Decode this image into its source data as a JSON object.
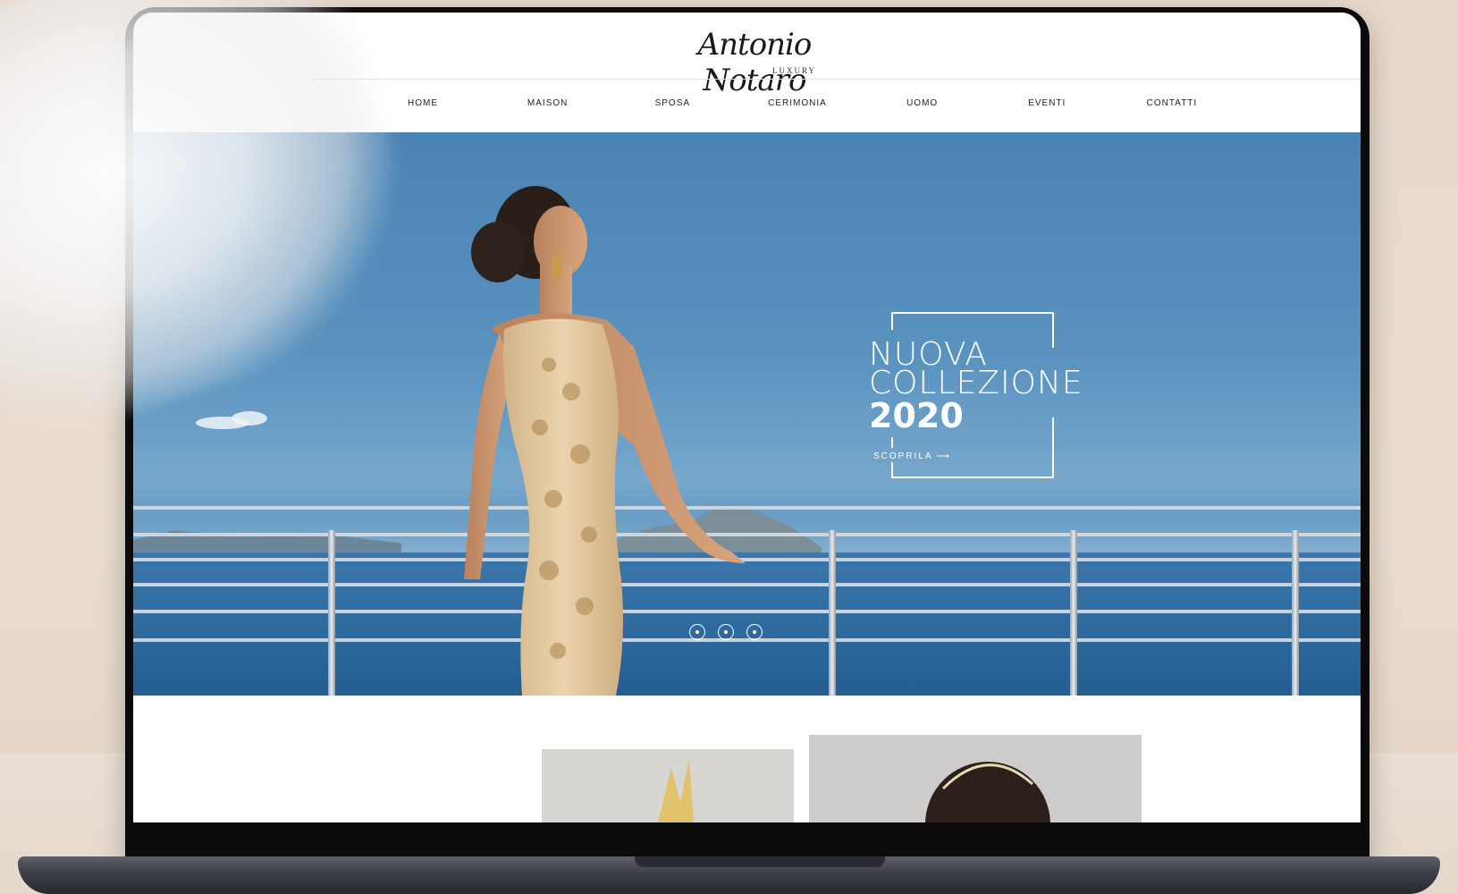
{
  "site": {
    "logo_script": "Antonio Notaro",
    "logo_sub": "LUXURY"
  },
  "nav": {
    "items": [
      "HOME",
      "MAISON",
      "SPOSA",
      "CERIMONIA",
      "UOMO",
      "EVENTI",
      "CONTATTI"
    ]
  },
  "hero": {
    "line1": "NUOVA",
    "line2": "COLLEZIONE",
    "year": "2020",
    "cta": "SCOPRILA ⟶",
    "slides": 3
  },
  "colors": {
    "sky": "#5a93c0",
    "sea": "#2f6b9f",
    "dress": "#e2c9a1"
  }
}
